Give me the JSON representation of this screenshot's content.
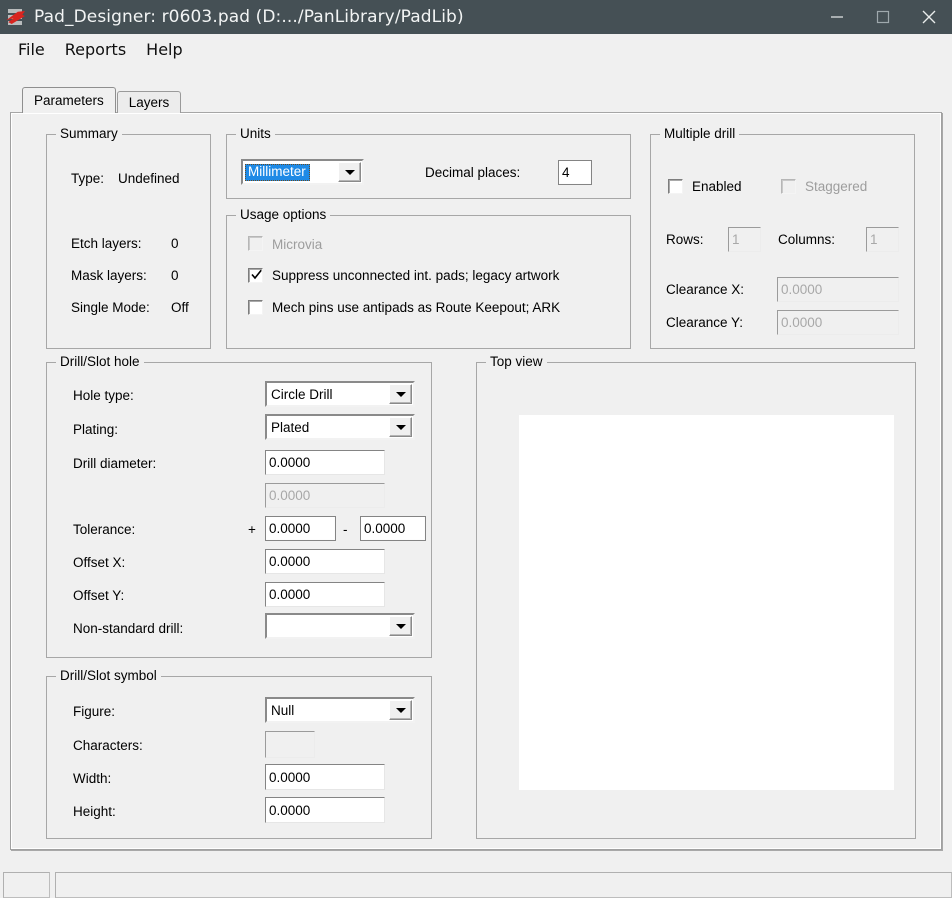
{
  "window": {
    "title": "Pad_Designer: r0603.pad (D:.../PanLibrary/PadLib)",
    "icon": "cadence-pad-designer-icon",
    "minimize_label": "minimize-icon",
    "maximize_label": "maximize-icon",
    "close_label": "close-icon"
  },
  "menubar": {
    "items": [
      {
        "label": "File"
      },
      {
        "label": "Reports"
      },
      {
        "label": "Help"
      }
    ]
  },
  "tabs": [
    {
      "label": "Parameters",
      "active": true
    },
    {
      "label": "Layers",
      "active": false
    }
  ],
  "summary": {
    "legend": "Summary",
    "type_label": "Type:",
    "type_value": "Undefined",
    "etch_label": "Etch layers:",
    "etch_value": "0",
    "mask_label": "Mask layers:",
    "mask_value": "0",
    "single_label": "Single Mode:",
    "single_value": "Off"
  },
  "units": {
    "legend": "Units",
    "value": "Millimeter",
    "decimal_label": "Decimal places:",
    "decimal_value": "4"
  },
  "usage_options": {
    "legend": "Usage options",
    "items": [
      {
        "label": "Microvia",
        "checked": false,
        "enabled": false
      },
      {
        "label": "Suppress unconnected int. pads; legacy artwork",
        "checked": true,
        "enabled": true
      },
      {
        "label": "Mech pins use antipads as Route Keepout; ARK",
        "checked": false,
        "enabled": true
      }
    ]
  },
  "multiple_drill": {
    "legend": "Multiple drill",
    "enabled_label": "Enabled",
    "enabled_checked": false,
    "staggered_label": "Staggered",
    "staggered_checked": false,
    "rows_label": "Rows:",
    "rows_value": "1",
    "columns_label": "Columns:",
    "columns_value": "1",
    "clearance_x_label": "Clearance X:",
    "clearance_x_value": "0.0000",
    "clearance_y_label": "Clearance Y:",
    "clearance_y_value": "0.0000"
  },
  "drill_slot_hole": {
    "legend": "Drill/Slot hole",
    "hole_type_label": "Hole type:",
    "hole_type_value": "Circle Drill",
    "plating_label": "Plating:",
    "plating_value": "Plated",
    "drill_diameter_label": "Drill diameter:",
    "drill_diameter_value": "0.0000",
    "drill_diameter2_value": "0.0000",
    "tolerance_label": "Tolerance:",
    "tolerance_plus_sign": "+",
    "tolerance_plus_value": "0.0000",
    "tolerance_minus_sign": "-",
    "tolerance_minus_value": "0.0000",
    "offset_x_label": "Offset X:",
    "offset_x_value": "0.0000",
    "offset_y_label": "Offset Y:",
    "offset_y_value": "0.0000",
    "non_standard_label": "Non-standard drill:",
    "non_standard_value": ""
  },
  "drill_slot_symbol": {
    "legend": "Drill/Slot symbol",
    "figure_label": "Figure:",
    "figure_value": "Null",
    "characters_label": "Characters:",
    "characters_value": "",
    "width_label": "Width:",
    "width_value": "0.0000",
    "height_label": "Height:",
    "height_value": "0.0000"
  },
  "top_view": {
    "legend": "Top view"
  },
  "statusbar": {
    "cell_left": "",
    "cell_right": ""
  },
  "colors": {
    "titlebar": "#455055",
    "panel": "#f0f0f0",
    "selection": "#1e8ae6",
    "accent_red": "#d8241f"
  }
}
